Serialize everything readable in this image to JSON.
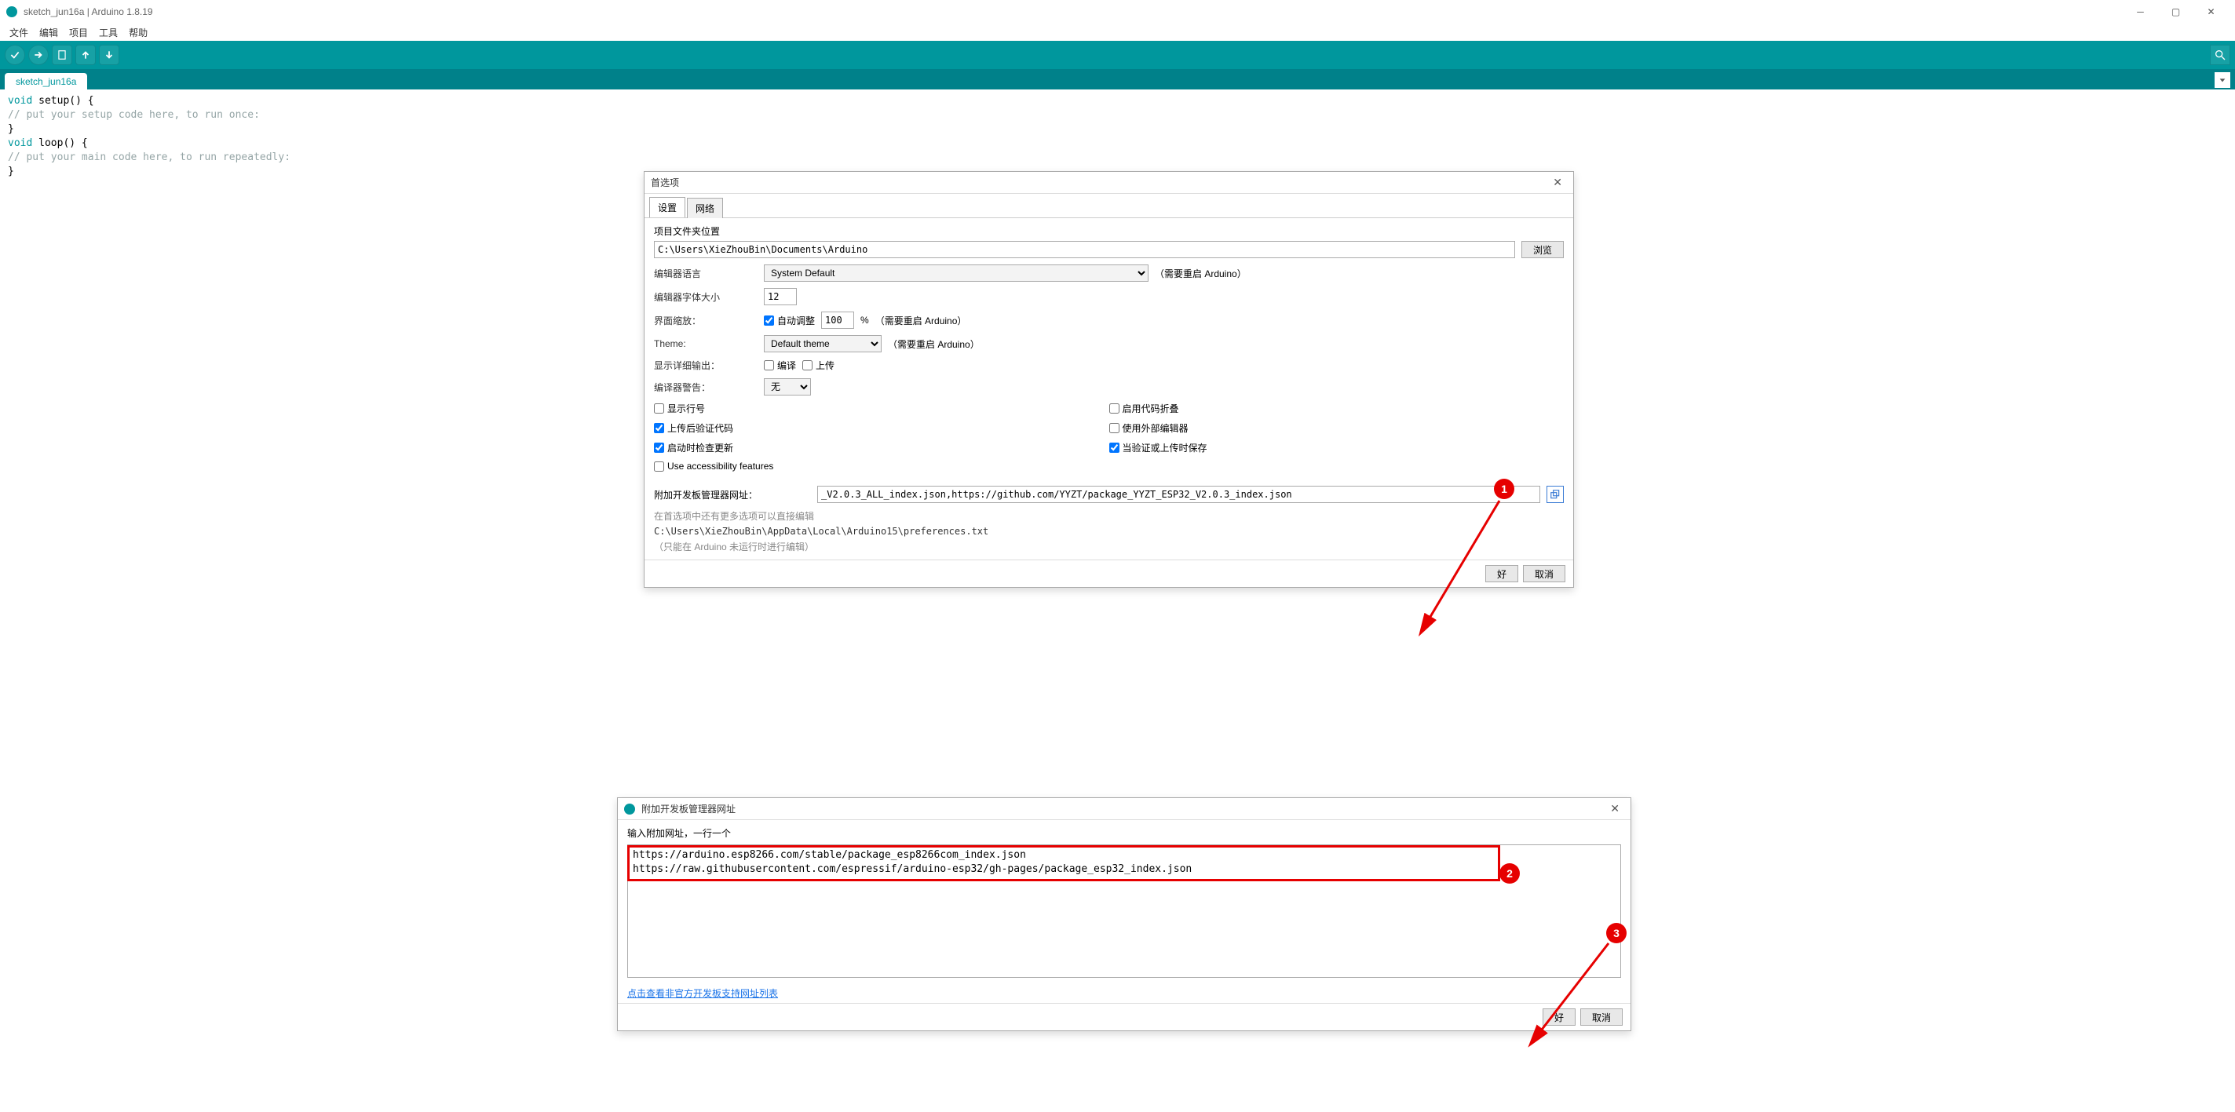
{
  "window": {
    "title": "sketch_jun16a | Arduino 1.8.19"
  },
  "menu": {
    "file": "文件",
    "edit": "编辑",
    "project": "项目",
    "tools": "工具",
    "help": "帮助"
  },
  "tabs": {
    "active": "sketch_jun16a"
  },
  "code": {
    "l1a": "void",
    "l1b": " setup() {",
    "l2": "  // put your setup code here, to run once:",
    "l3": "",
    "l4": "}",
    "l5": "",
    "l6a": "void",
    "l6b": " loop() {",
    "l7": "  // put your main code here, to run repeatedly:",
    "l8": "",
    "l9": "}"
  },
  "pref": {
    "title": "首选项",
    "tab_settings": "设置",
    "tab_network": "网络",
    "sketchbook_label": "项目文件夹位置",
    "sketchbook_path": "C:\\Users\\XieZhouBin\\Documents\\Arduino",
    "browse": "浏览",
    "lang_label": "编辑器语言",
    "lang_value": "System Default",
    "restart1": "（需要重启 Arduino）",
    "fontsize_label": "编辑器字体大小",
    "fontsize_value": "12",
    "scale_label": "界面缩放：",
    "auto_scale": "自动调整",
    "scale_value": "100",
    "scale_pct": "%",
    "restart2": "（需要重启 Arduino）",
    "theme_label": "Theme:",
    "theme_value": "Default theme",
    "restart3": "（需要重启 Arduino）",
    "verbose_label": "显示详细输出：",
    "verbose_compile": "编译",
    "verbose_upload": "上传",
    "warn_label": "编译器警告：",
    "warn_value": "无",
    "cb_linenum": "显示行号",
    "cb_codefold": "启用代码折叠",
    "cb_verify": "上传后验证代码",
    "cb_external": "使用外部编辑器",
    "cb_checkupdate": "启动时检查更新",
    "cb_savecompile": "当验证或上传时保存",
    "cb_accessibility": "Use accessibility features",
    "boards_url_label": "附加开发板管理器网址：",
    "boards_url_value": "_V2.0.3_ALL_index.json,https://github.com/YYZT/package_YYZT_ESP32_V2.0.3_index.json",
    "more_note": "在首选项中还有更多选项可以直接编辑",
    "prefs_path": "C:\\Users\\XieZhouBin\\AppData\\Local\\Arduino15\\preferences.txt",
    "edit_note": "（只能在 Arduino 未运行时进行编辑）",
    "ok": "好",
    "cancel": "取消"
  },
  "url_dlg": {
    "title": "附加开发板管理器网址",
    "hint": "输入附加网址，一行一个",
    "text": "https://arduino.esp8266.com/stable/package_esp8266com_index.json\nhttps://raw.githubusercontent.com/espressif/arduino-esp32/gh-pages/package_esp32_index.json",
    "link": "点击查看非官方开发板支持网址列表",
    "ok": "好",
    "cancel": "取消"
  },
  "annot": {
    "n1": "1",
    "n2": "2",
    "n3": "3"
  }
}
